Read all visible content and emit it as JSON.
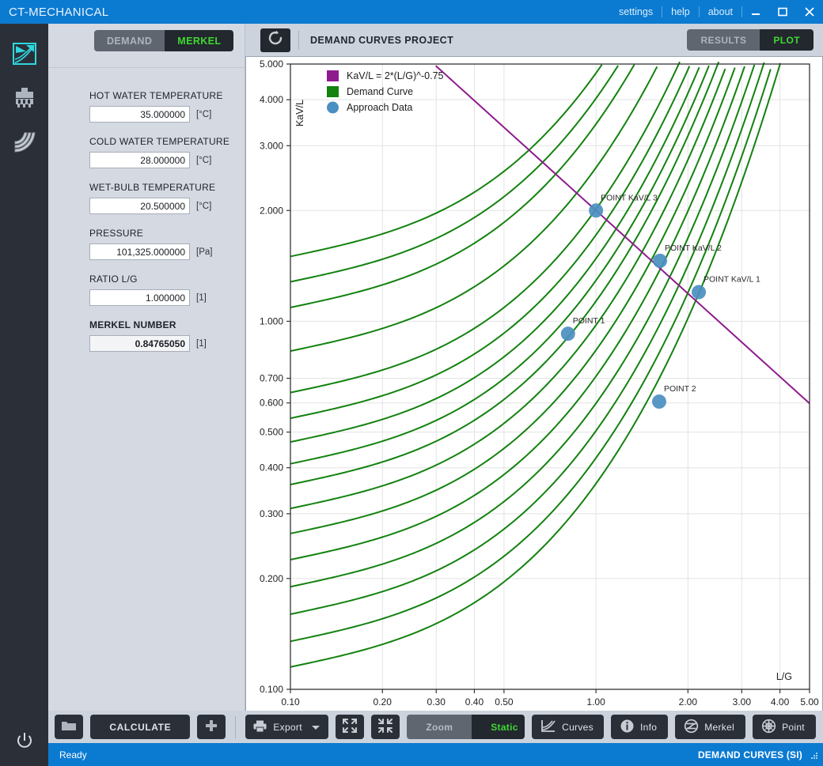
{
  "titlebar": {
    "app_title": "CT-MECHANICAL",
    "links": [
      "settings",
      "help",
      "about"
    ],
    "window_buttons": [
      "minimize-icon",
      "maximize-icon",
      "close-icon"
    ],
    "accent_color": "#0b7ad1"
  },
  "rail": {
    "items": [
      {
        "name": "psychrometric-chart-icon",
        "active": true
      },
      {
        "name": "cooling-tower-icon",
        "active": false
      },
      {
        "name": "performance-curves-icon",
        "active": false
      }
    ],
    "power": {
      "name": "power-icon"
    }
  },
  "panel": {
    "tabs": [
      {
        "label": "DEMAND",
        "active": false
      },
      {
        "label": "MERKEL",
        "active": true
      }
    ],
    "fields": [
      {
        "label": "HOT WATER TEMPERATURE",
        "value": "35.000000",
        "unit": "[°C]",
        "readonly": false
      },
      {
        "label": "COLD WATER TEMPERATURE",
        "value": "28.000000",
        "unit": "[°C]",
        "readonly": false
      },
      {
        "label": "WET-BULB TEMPERATURE",
        "value": "20.500000",
        "unit": "[°C]",
        "readonly": false
      },
      {
        "label": "PRESSURE",
        "value": "101,325.000000",
        "unit": "[Pa]",
        "readonly": false
      },
      {
        "label": "RATIO L/G",
        "value": "1.000000",
        "unit": "[1]",
        "readonly": false
      },
      {
        "label": "MERKEL NUMBER",
        "value": "0.84765050",
        "unit": "[1]",
        "readonly": true
      }
    ]
  },
  "header": {
    "refresh_icon": "refresh-icon",
    "project_title": "DEMAND CURVES PROJECT",
    "view_tabs": [
      {
        "label": "RESULTS",
        "active": false
      },
      {
        "label": "PLOT",
        "active": true
      }
    ]
  },
  "toolbar": {
    "open_icon": "folder-icon",
    "calculate_label": "CALCULATE",
    "add_icon": "plus-icon",
    "export_label": "Export",
    "export_icon": "printer-icon",
    "expand_icon": "expand-icon",
    "collapse_icon": "collapse-icon",
    "zoom_mode": [
      {
        "label": "Zoom",
        "active": false
      },
      {
        "label": "Static",
        "active": true
      }
    ],
    "curves_label": "Curves",
    "curves_icon": "curves-icon",
    "info_label": "Info",
    "info_icon": "info-icon",
    "merkel_label": "Merkel",
    "merkel_icon": "merkel-icon",
    "point_label": "Point",
    "point_icon": "target-icon"
  },
  "statusbar": {
    "status": "Ready",
    "project": "DEMAND CURVES (SI)"
  },
  "chart_data": {
    "type": "line",
    "title": "",
    "xlabel": "L/G",
    "ylabel": "KaV/L",
    "xscale": "log",
    "yscale": "log",
    "xlim": [
      0.1,
      5.0
    ],
    "ylim": [
      0.1,
      5.0
    ],
    "xticks": [
      "0.10",
      "0.20",
      "0.30",
      "0.40",
      "0.50",
      "1.00",
      "2.00",
      "3.00",
      "4.00",
      "5.00"
    ],
    "xtick_values": [
      0.1,
      0.2,
      0.3,
      0.4,
      0.5,
      1.0,
      2.0,
      3.0,
      4.0,
      5.0
    ],
    "yticks": [
      "0.100",
      "0.200",
      "0.300",
      "0.400",
      "0.500",
      "0.600",
      "0.700",
      "1.000",
      "2.000",
      "3.000",
      "4.000",
      "5.000"
    ],
    "ytick_values": [
      0.1,
      0.2,
      0.3,
      0.4,
      0.5,
      0.6,
      0.7,
      1.0,
      2.0,
      3.0,
      4.0,
      5.0
    ],
    "grid": true,
    "legend_position": "top-left",
    "legend": [
      {
        "label": "KaV/L = 2*(L/G)^-0.75",
        "color": "#8e1b8e",
        "marker": "square"
      },
      {
        "label": "Demand Curve",
        "color": "#13820f",
        "marker": "square"
      },
      {
        "label": "Approach Data",
        "color": "#4b8fc0",
        "marker": "circle"
      }
    ],
    "series": [
      {
        "name": "KaV/L = 2*(L/G)^-0.75",
        "color": "#8e1b8e",
        "type": "line",
        "coefficient": 2.0,
        "exponent": -0.75,
        "x": [
          0.3,
          0.5,
          1.0,
          2.0,
          3.0,
          5.0
        ],
        "y": [
          4.93,
          3.36,
          2.0,
          1.19,
          0.88,
          0.6
        ]
      },
      {
        "name": "Demand Curve",
        "color": "#13820f",
        "type": "family",
        "description": "Family of 16 cooling-tower demand curves, rising with L/G, asymptotic at high L/G",
        "curve_count": 16,
        "y_at_xmin": [
          0.115,
          0.135,
          0.16,
          0.19,
          0.225,
          0.265,
          0.31,
          0.36,
          0.41,
          0.47,
          0.545,
          0.64,
          0.83,
          1.09,
          1.28,
          1.5
        ]
      }
    ],
    "points": [
      {
        "label": "POINT KaV/L 3",
        "x": 1.0,
        "y": 2.0,
        "color": "#4b8fc0",
        "label_position": "above-right"
      },
      {
        "label": "POINT KaV/L 2",
        "x": 1.62,
        "y": 1.46,
        "color": "#4b8fc0",
        "label_position": "above-right"
      },
      {
        "label": "POINT KaV/L 1",
        "x": 2.17,
        "y": 1.2,
        "color": "#4b8fc0",
        "label_position": "above-right"
      },
      {
        "label": "POINT 1",
        "x": 0.81,
        "y": 0.925,
        "color": "#4b8fc0",
        "label_position": "above-right"
      },
      {
        "label": "POINT 2",
        "x": 1.61,
        "y": 0.605,
        "color": "#4b8fc0",
        "label_position": "above-right"
      }
    ]
  }
}
